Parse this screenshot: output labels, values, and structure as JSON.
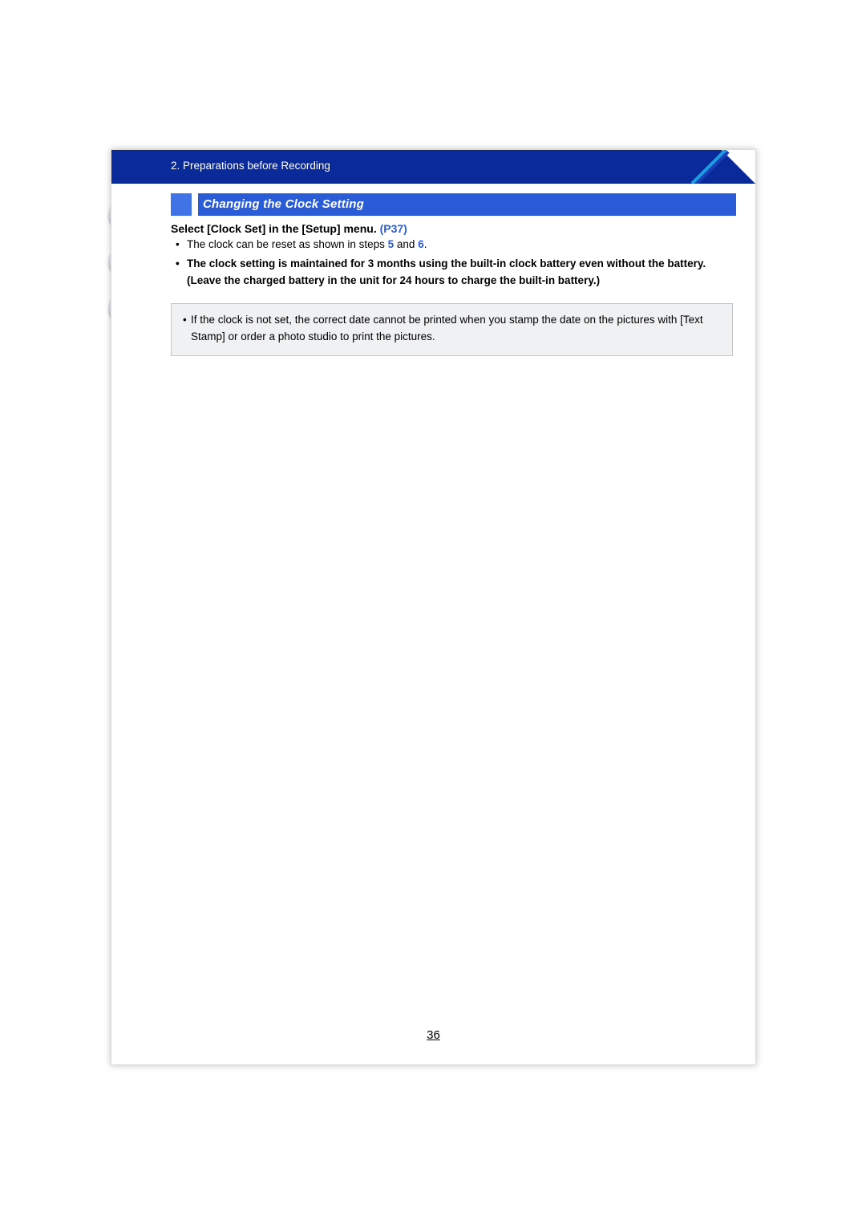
{
  "sidebar": {
    "icons": [
      "home-icon",
      "toc-icon",
      "back-icon"
    ]
  },
  "header": {
    "breadcrumb_prefix": "2.",
    "breadcrumb_text": "Preparations before Recording"
  },
  "section": {
    "title": "Changing the Clock Setting"
  },
  "instruction": {
    "text": "Select [Clock Set] in the [Setup] menu.",
    "page_ref": "(P37)"
  },
  "bullets": {
    "b1_part1": "The clock can be reset as shown in steps ",
    "b1_step1": "5",
    "b1_mid": " and ",
    "b1_step2": "6",
    "b1_end": ".",
    "b2_line1": "The clock setting is maintained for 3 months using the built-in clock battery even without the battery.",
    "b2_line2": "(Leave the charged battery in the unit for 24 hours to charge the built-in battery.)"
  },
  "notebox": {
    "text": "If the clock is not set, the correct date cannot be printed when you stamp the date on the pictures with [Text Stamp] or order a photo studio to print the pictures."
  },
  "page_number": "36"
}
